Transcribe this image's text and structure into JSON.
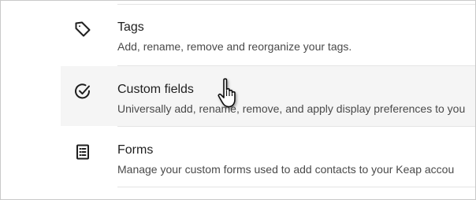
{
  "settings_list": {
    "items": [
      {
        "icon": "tag-icon",
        "title": "Tags",
        "description": "Add, rename, remove and reorganize your tags.",
        "hovered": false
      },
      {
        "icon": "check-circle-icon",
        "title": "Custom fields",
        "description": "Universally add, rename, remove, and apply display preferences to you",
        "hovered": true
      },
      {
        "icon": "form-icon",
        "title": "Forms",
        "description": "Manage your custom forms used to add contacts to your Keap accou",
        "hovered": false
      }
    ]
  },
  "cursor": {
    "icon": "hand-pointer-cursor-icon"
  },
  "colors": {
    "hover_background": "#f5f5f5",
    "divider": "#e4e4e4",
    "title_text": "#1f1f1f",
    "description_text": "#4a4a4a"
  }
}
